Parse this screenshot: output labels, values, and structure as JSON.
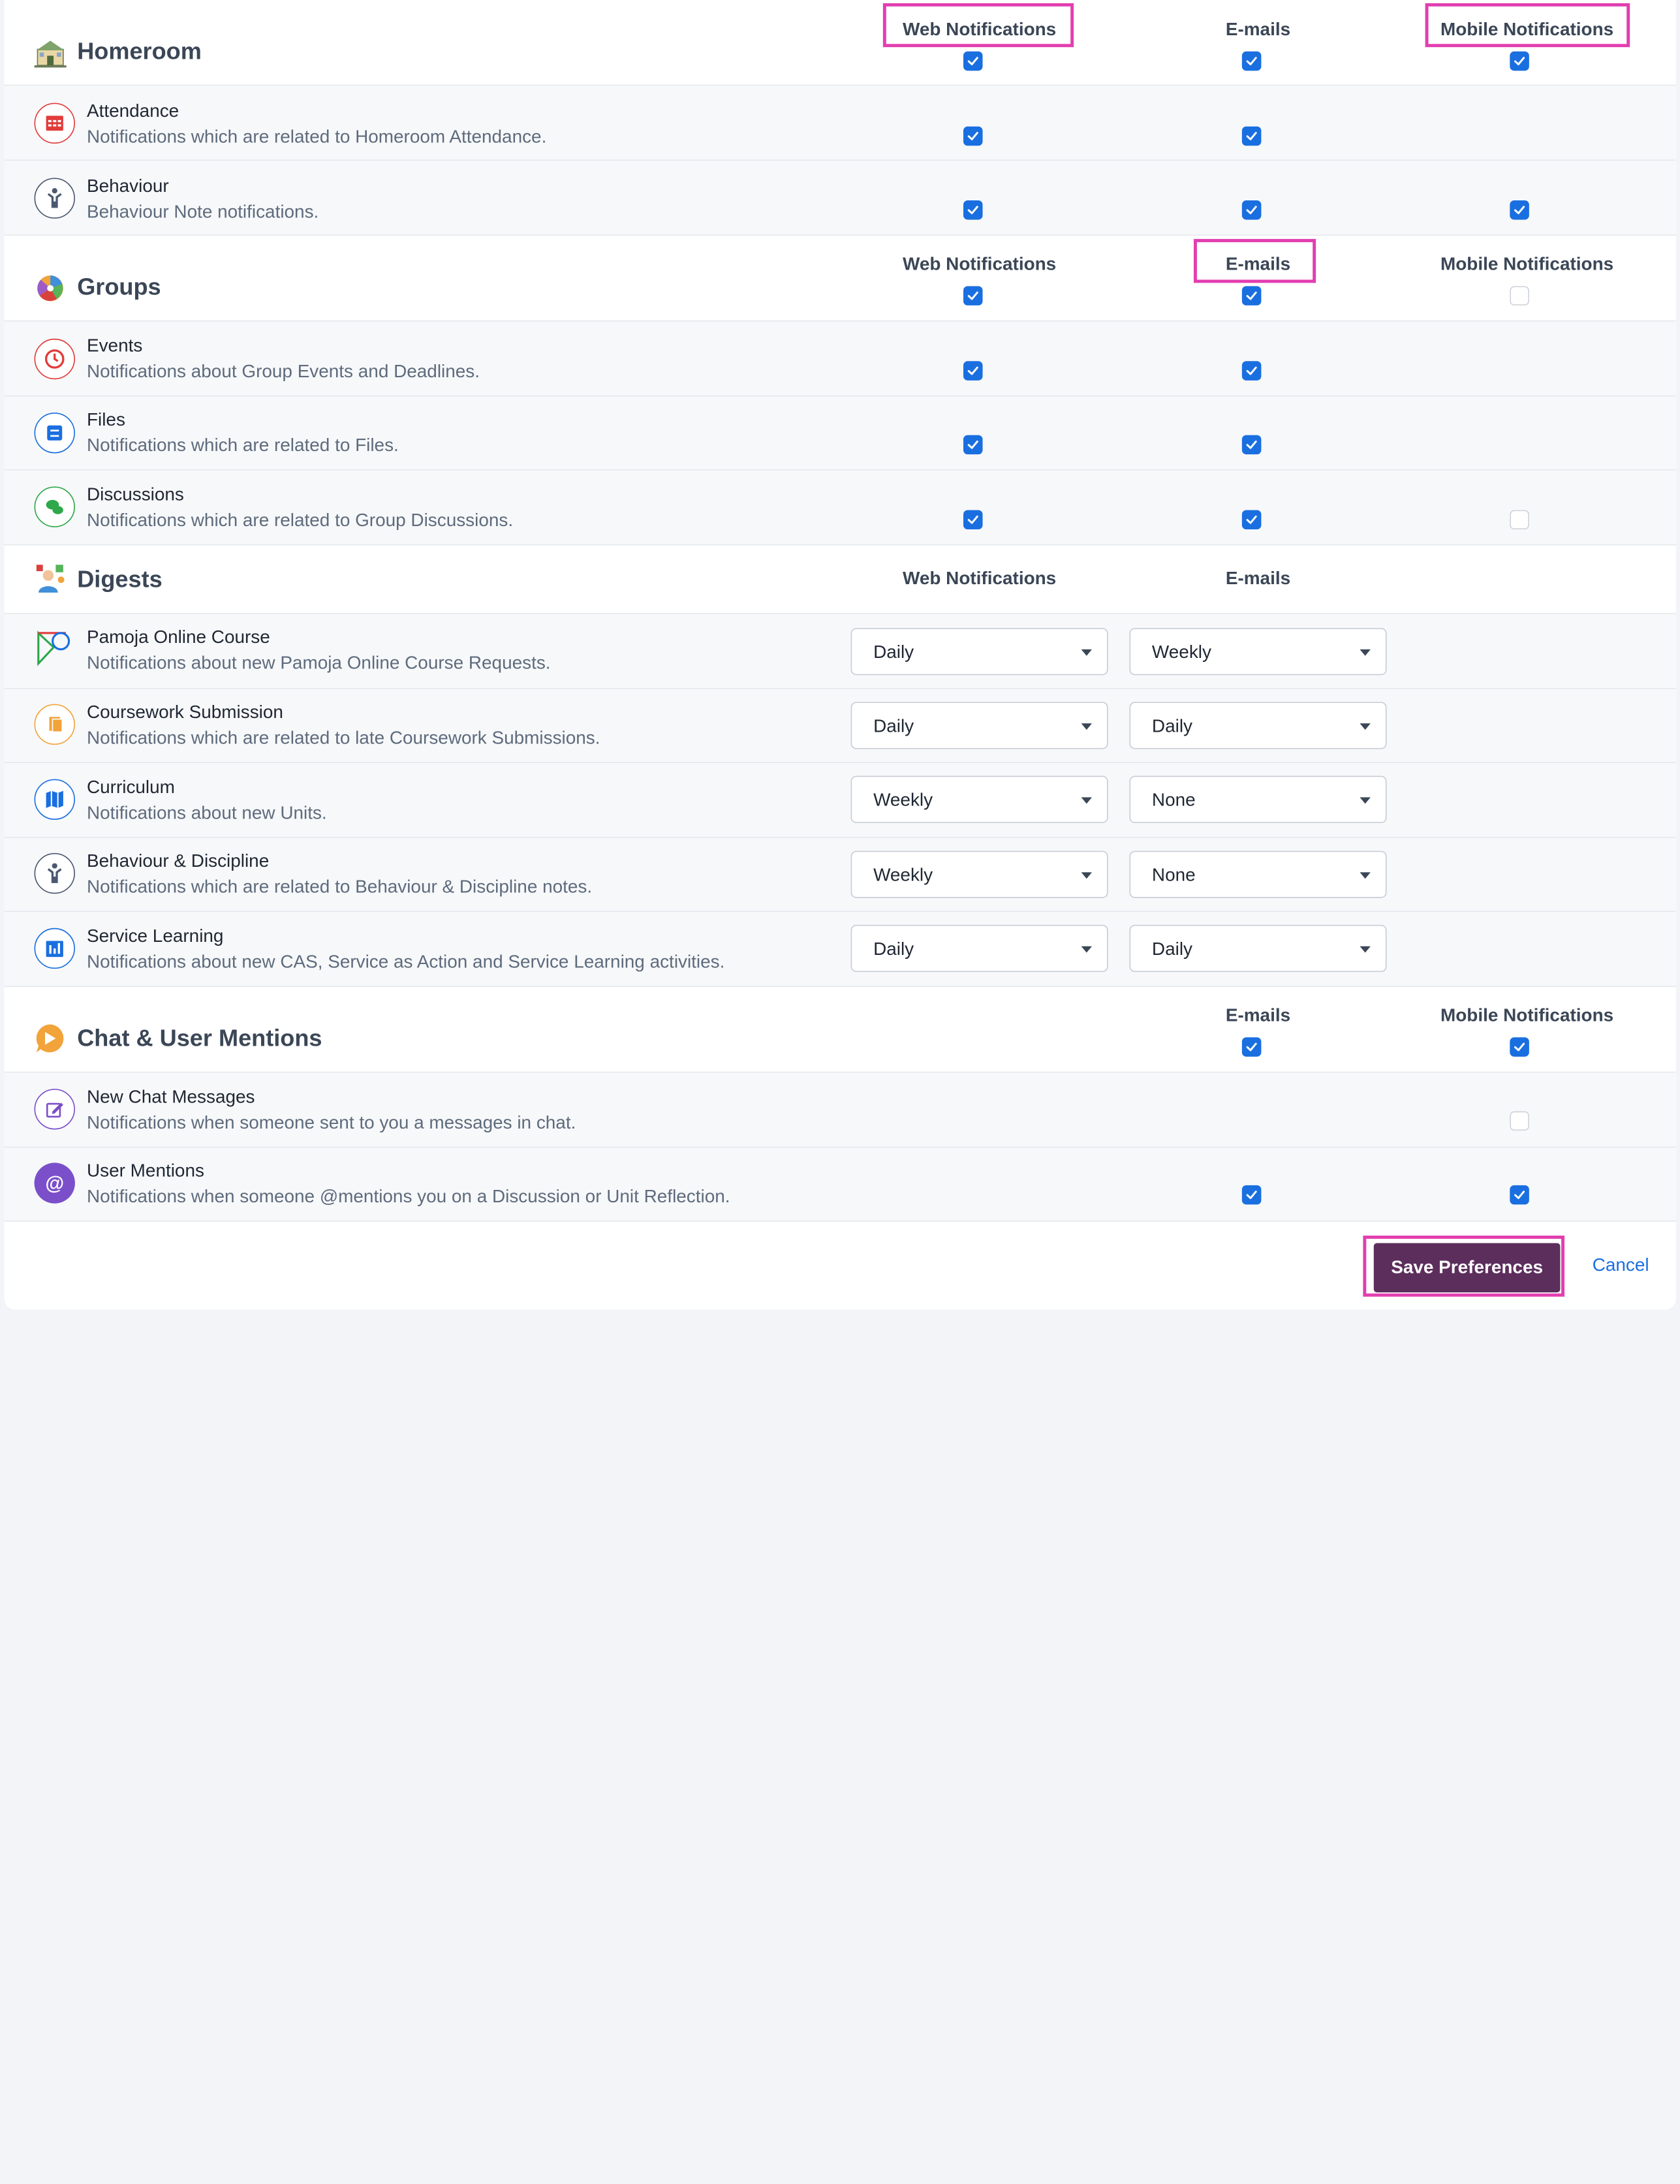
{
  "columns": {
    "web": "Web Notifications",
    "email": "E-mails",
    "mobile": "Mobile Notifications"
  },
  "homeroom": {
    "title": "Homeroom",
    "items": [
      {
        "title": "Attendance",
        "desc": "Notifications which are related to Homeroom Attendance."
      },
      {
        "title": "Behaviour",
        "desc": "Behaviour Note notifications."
      }
    ]
  },
  "groups": {
    "title": "Groups",
    "items": [
      {
        "title": "Events",
        "desc": "Notifications about Group Events and Deadlines."
      },
      {
        "title": "Files",
        "desc": "Notifications which are related to Files."
      },
      {
        "title": "Discussions",
        "desc": "Notifications which are related to Group Discussions."
      }
    ]
  },
  "digests": {
    "title": "Digests",
    "items": [
      {
        "title": "Pamoja Online Course",
        "desc": "Notifications about new Pamoja Online Course Requests.",
        "web": "Daily",
        "email": "Weekly"
      },
      {
        "title": "Coursework Submission",
        "desc": "Notifications which are related to late Coursework Submissions.",
        "web": "Daily",
        "email": "Daily"
      },
      {
        "title": "Curriculum",
        "desc": "Notifications about new Units.",
        "web": "Weekly",
        "email": "None"
      },
      {
        "title": "Behaviour & Discipline",
        "desc": "Notifications which are related to Behaviour & Discipline notes.",
        "web": "Weekly",
        "email": "None"
      },
      {
        "title": "Service Learning",
        "desc": "Notifications about new CAS, Service as Action and Service Learning activities.",
        "web": "Daily",
        "email": "Daily"
      }
    ]
  },
  "chat": {
    "title": "Chat & User Mentions",
    "items": [
      {
        "title": "New Chat Messages",
        "desc": "Notifications when someone sent to you a messages in chat."
      },
      {
        "title": "User Mentions",
        "desc": "Notifications when someone @mentions you on a Discussion or Unit Reflection."
      }
    ]
  },
  "checkbox_states": {
    "homeroom_all": [
      true,
      true,
      true
    ],
    "attendance": [
      true,
      true
    ],
    "behaviour": [
      true,
      true,
      true
    ],
    "groups_all": [
      true,
      true,
      false
    ],
    "events": [
      true,
      true
    ],
    "files": [
      true,
      true
    ],
    "discussions": [
      true,
      true,
      false
    ],
    "chat_all": [
      true,
      true
    ],
    "new_chat_messages": [
      false
    ],
    "user_mentions": [
      true,
      true
    ]
  },
  "footer": {
    "save_label": "Save Preferences",
    "cancel_label": "Cancel"
  },
  "colors": {
    "checkbox_on": "#1a6fe0",
    "save_button": "#5c2e5c",
    "highlight": "#e23eb0",
    "link": "#1a6fe0"
  }
}
